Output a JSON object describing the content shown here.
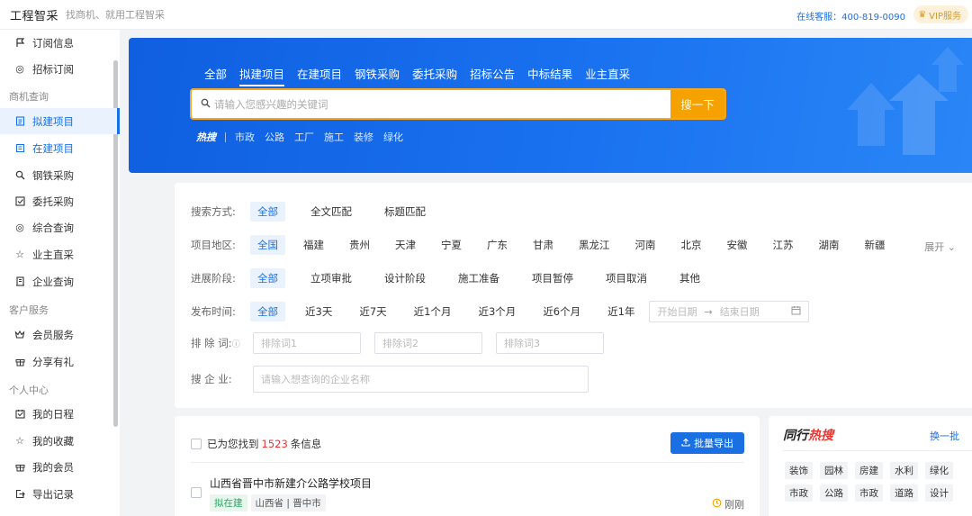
{
  "header": {
    "logo": "工程智采",
    "slogan": "找商机、就用工程智采",
    "hotline": "在线客服：400-819-0090",
    "vip_label": "VIP服务"
  },
  "sidebar": {
    "items": [
      {
        "label": "订阅信息",
        "icon": "flag-icon"
      },
      {
        "label": "招标订阅",
        "icon": "subscribe-icon"
      },
      {
        "group": "商机查询"
      },
      {
        "label": "拟建项目",
        "icon": "document-icon",
        "active": true
      },
      {
        "label": "在建项目",
        "icon": "building-icon"
      },
      {
        "label": "钢铁采购",
        "icon": "search-icon"
      },
      {
        "label": "委托采购",
        "icon": "checkbox-icon"
      },
      {
        "label": "综合查询",
        "icon": "query-icon"
      },
      {
        "label": "业主直采",
        "icon": "star-icon"
      },
      {
        "label": "企业查询",
        "icon": "company-icon"
      },
      {
        "group": "客户服务"
      },
      {
        "label": "会员服务",
        "icon": "crown-icon"
      },
      {
        "label": "分享有礼",
        "icon": "gift-icon"
      },
      {
        "group": "个人中心"
      },
      {
        "label": "我的日程",
        "icon": "calendar-icon"
      },
      {
        "label": "我的收藏",
        "icon": "star-icon"
      },
      {
        "label": "我的会员",
        "icon": "gift-icon"
      },
      {
        "label": "导出记录",
        "icon": "export-icon"
      }
    ]
  },
  "banner": {
    "tabs": [
      "全部",
      "拟建项目",
      "在建项目",
      "钢铁采购",
      "委托采购",
      "招标公告",
      "中标结果",
      "业主直采"
    ],
    "search_placeholder": "请输入您感兴趣的关键词",
    "search_button": "搜一下",
    "hot_label": "热搜",
    "hot_keywords": [
      "市政",
      "公路",
      "工厂",
      "施工",
      "装修",
      "绿化"
    ]
  },
  "filters": {
    "search_mode": {
      "label": "搜索方式:",
      "options": [
        "全部",
        "全文匹配",
        "标题匹配"
      ]
    },
    "region": {
      "label": "项目地区:",
      "options": [
        "全国",
        "福建",
        "贵州",
        "天津",
        "宁夏",
        "广东",
        "甘肃",
        "黑龙江",
        "河南",
        "北京",
        "安徽",
        "江苏",
        "湖南",
        "新疆"
      ],
      "expand": "展开"
    },
    "stage": {
      "label": "进展阶段:",
      "options": [
        "全部",
        "立项审批",
        "设计阶段",
        "施工准备",
        "项目暂停",
        "项目取消",
        "其他"
      ]
    },
    "time": {
      "label": "发布时间:",
      "options": [
        "全部",
        "近3天",
        "近7天",
        "近1个月",
        "近3个月",
        "近6个月",
        "近1年"
      ],
      "start_placeholder": "开始日期",
      "end_placeholder": "结束日期"
    },
    "exclude": {
      "label": "排 除 词:",
      "placeholders": [
        "排除词1",
        "排除词2",
        "排除词3"
      ]
    },
    "company": {
      "label": "搜 企 业:",
      "placeholder": "请输入想查询的企业名称"
    }
  },
  "results": {
    "found_prefix": "已为您找到",
    "count": "1523",
    "found_suffix": "条信息",
    "export_button": "批量导出",
    "items": [
      {
        "title": "山西省晋中市新建介公路学校项目",
        "tags": [
          "拟在建",
          "山西省 | 晋中市"
        ],
        "time": "刚刚"
      }
    ]
  },
  "hot_panel": {
    "title_prefix": "同行",
    "title_highlight": "热搜",
    "refresh": "换一批",
    "tags": [
      "装饰",
      "园林",
      "房建",
      "水利",
      "绿化",
      "市政",
      "公路",
      "市政",
      "道路",
      "设计"
    ]
  }
}
